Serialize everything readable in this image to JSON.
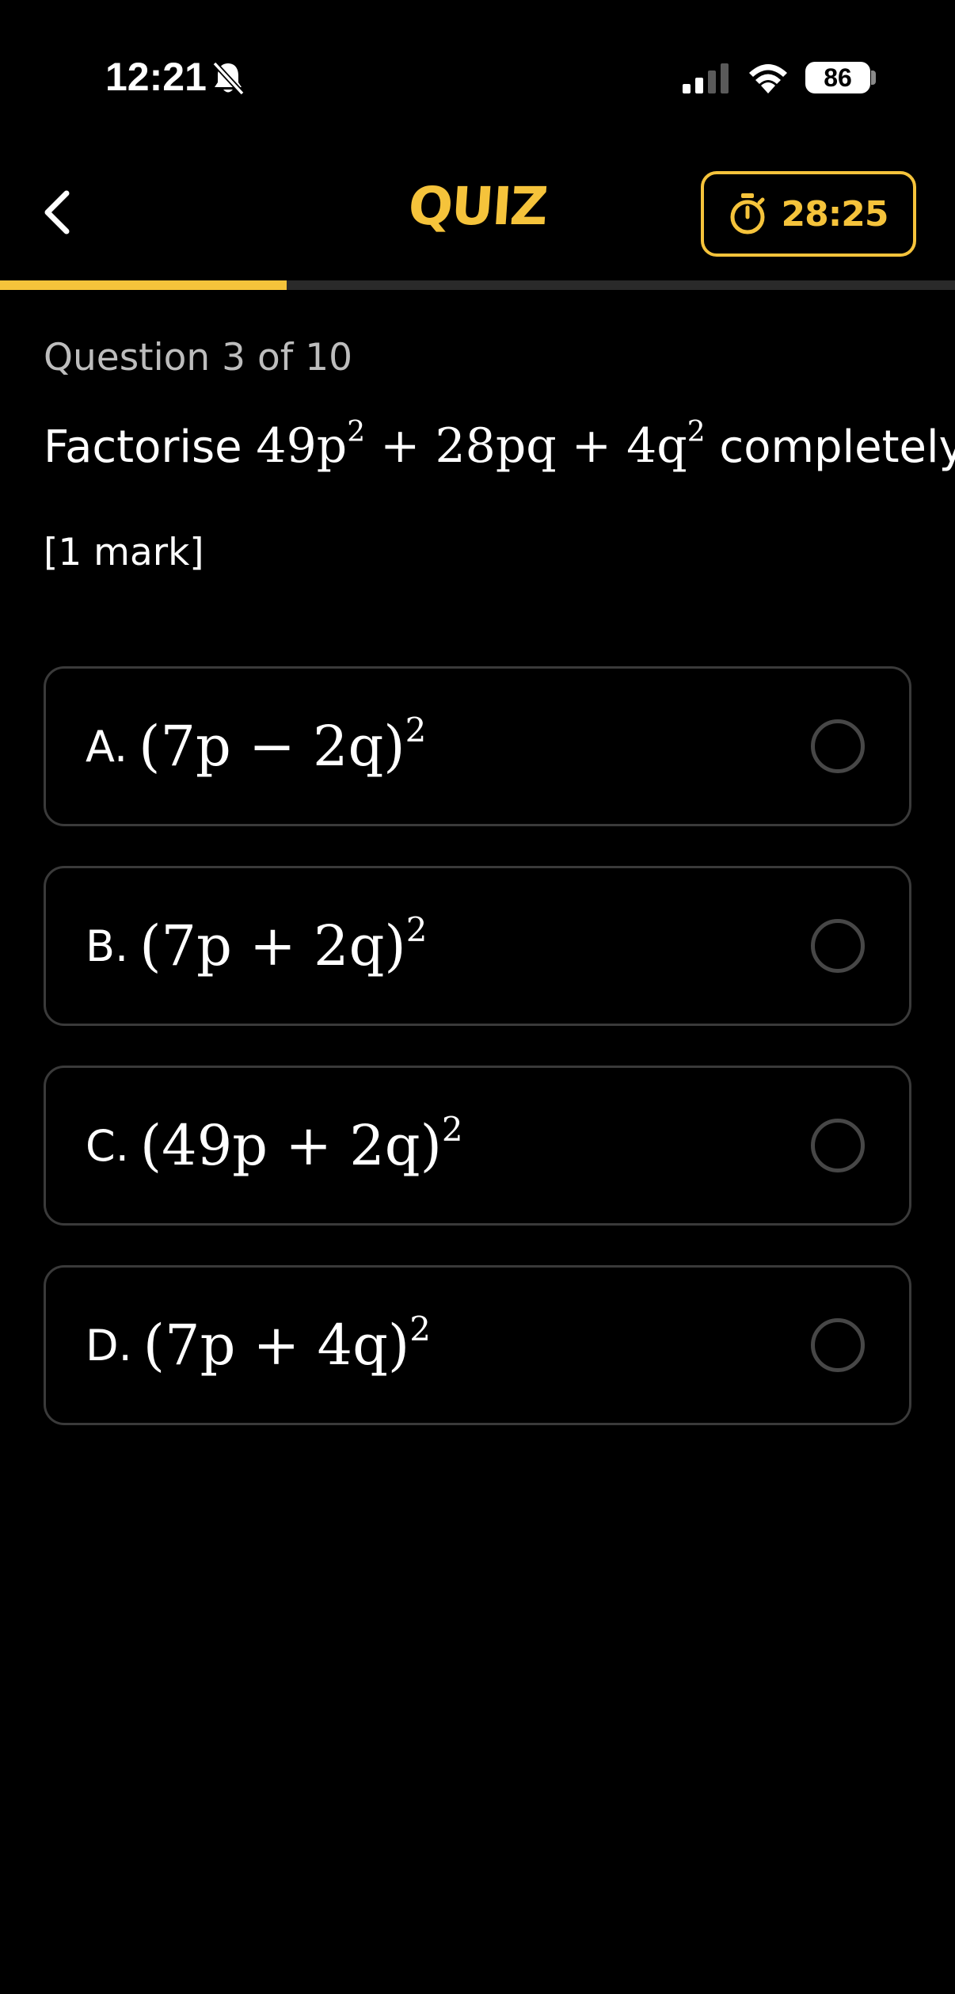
{
  "status_bar": {
    "time": "12:21",
    "battery": "86",
    "icons": [
      "bell-slash-icon",
      "cellular-signal-icon",
      "wifi-icon",
      "battery-icon"
    ]
  },
  "header": {
    "title": "QUIZ",
    "timer": "28:25",
    "back_icon": "chevron-left-icon",
    "timer_icon": "stopwatch-icon"
  },
  "progress": {
    "fraction": 0.3
  },
  "question": {
    "counter": "Question 3 of 10",
    "prefix": "Factorise",
    "expr_a": "49p",
    "sup_a": "2",
    "expr_b": " + 28pq + 4q",
    "sup_b": "2",
    "suffix": "completely.",
    "marks": "[1 mark]"
  },
  "options": [
    {
      "letter": "A.",
      "expr": "(7p − 2q)",
      "sup": "2"
    },
    {
      "letter": "B.",
      "expr": "(7p + 2q)",
      "sup": "2"
    },
    {
      "letter": "C.",
      "expr": "(49p + 2q)",
      "sup": "2"
    },
    {
      "letter": "D.",
      "expr": "(7p + 4q)",
      "sup": "2"
    }
  ],
  "colors": {
    "accent": "#F5C33B",
    "background": "#000000",
    "option_border": "#3a3a3a",
    "muted_text": "#bdbdbd"
  }
}
